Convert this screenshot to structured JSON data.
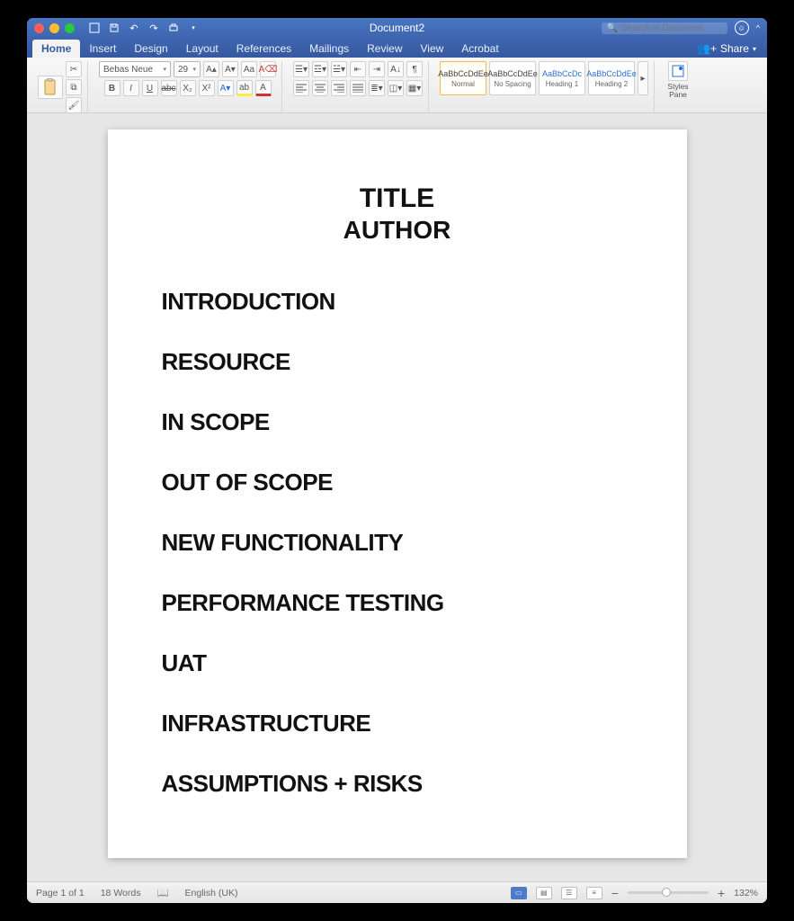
{
  "window": {
    "title": "Document2"
  },
  "qat": {
    "save": "⎙",
    "undo": "↶",
    "redo": "↷",
    "print": "⎙"
  },
  "search": {
    "placeholder": "Search in Document"
  },
  "tabs": [
    "Home",
    "Insert",
    "Design",
    "Layout",
    "References",
    "Mailings",
    "Review",
    "View",
    "Acrobat"
  ],
  "active_tab": "Home",
  "share": "Share",
  "ribbon": {
    "paste_label": "Paste",
    "font_name": "Bebas Neue",
    "font_size": "29",
    "bold": "B",
    "italic": "I",
    "underline": "U",
    "strike": "abc",
    "sub": "X₂",
    "sup": "X²",
    "styles": [
      {
        "preview": "AaBbCcDdEe",
        "label": "Normal",
        "blue": false,
        "selected": true
      },
      {
        "preview": "AaBbCcDdEe",
        "label": "No Spacing",
        "blue": false,
        "selected": false
      },
      {
        "preview": "AaBbCcDc",
        "label": "Heading 1",
        "blue": true,
        "selected": false
      },
      {
        "preview": "AaBbCcDdEe",
        "label": "Heading 2",
        "blue": true,
        "selected": false
      }
    ],
    "styles_pane": "Styles\nPane"
  },
  "document": {
    "title": "TITLE",
    "author": "AUTHOR",
    "sections": [
      "INTRODUCTION",
      "RESOURCE",
      "IN SCOPE",
      "OUT OF SCOPE",
      "NEW FUNCTIONALITY",
      "PERFORMANCE TESTING",
      "UAT",
      "INFRASTRUCTURE",
      "ASSUMPTIONS + RISKS"
    ]
  },
  "status": {
    "page": "Page 1 of 1",
    "words": "18 Words",
    "lang": "English (UK)",
    "zoom": "132%"
  }
}
